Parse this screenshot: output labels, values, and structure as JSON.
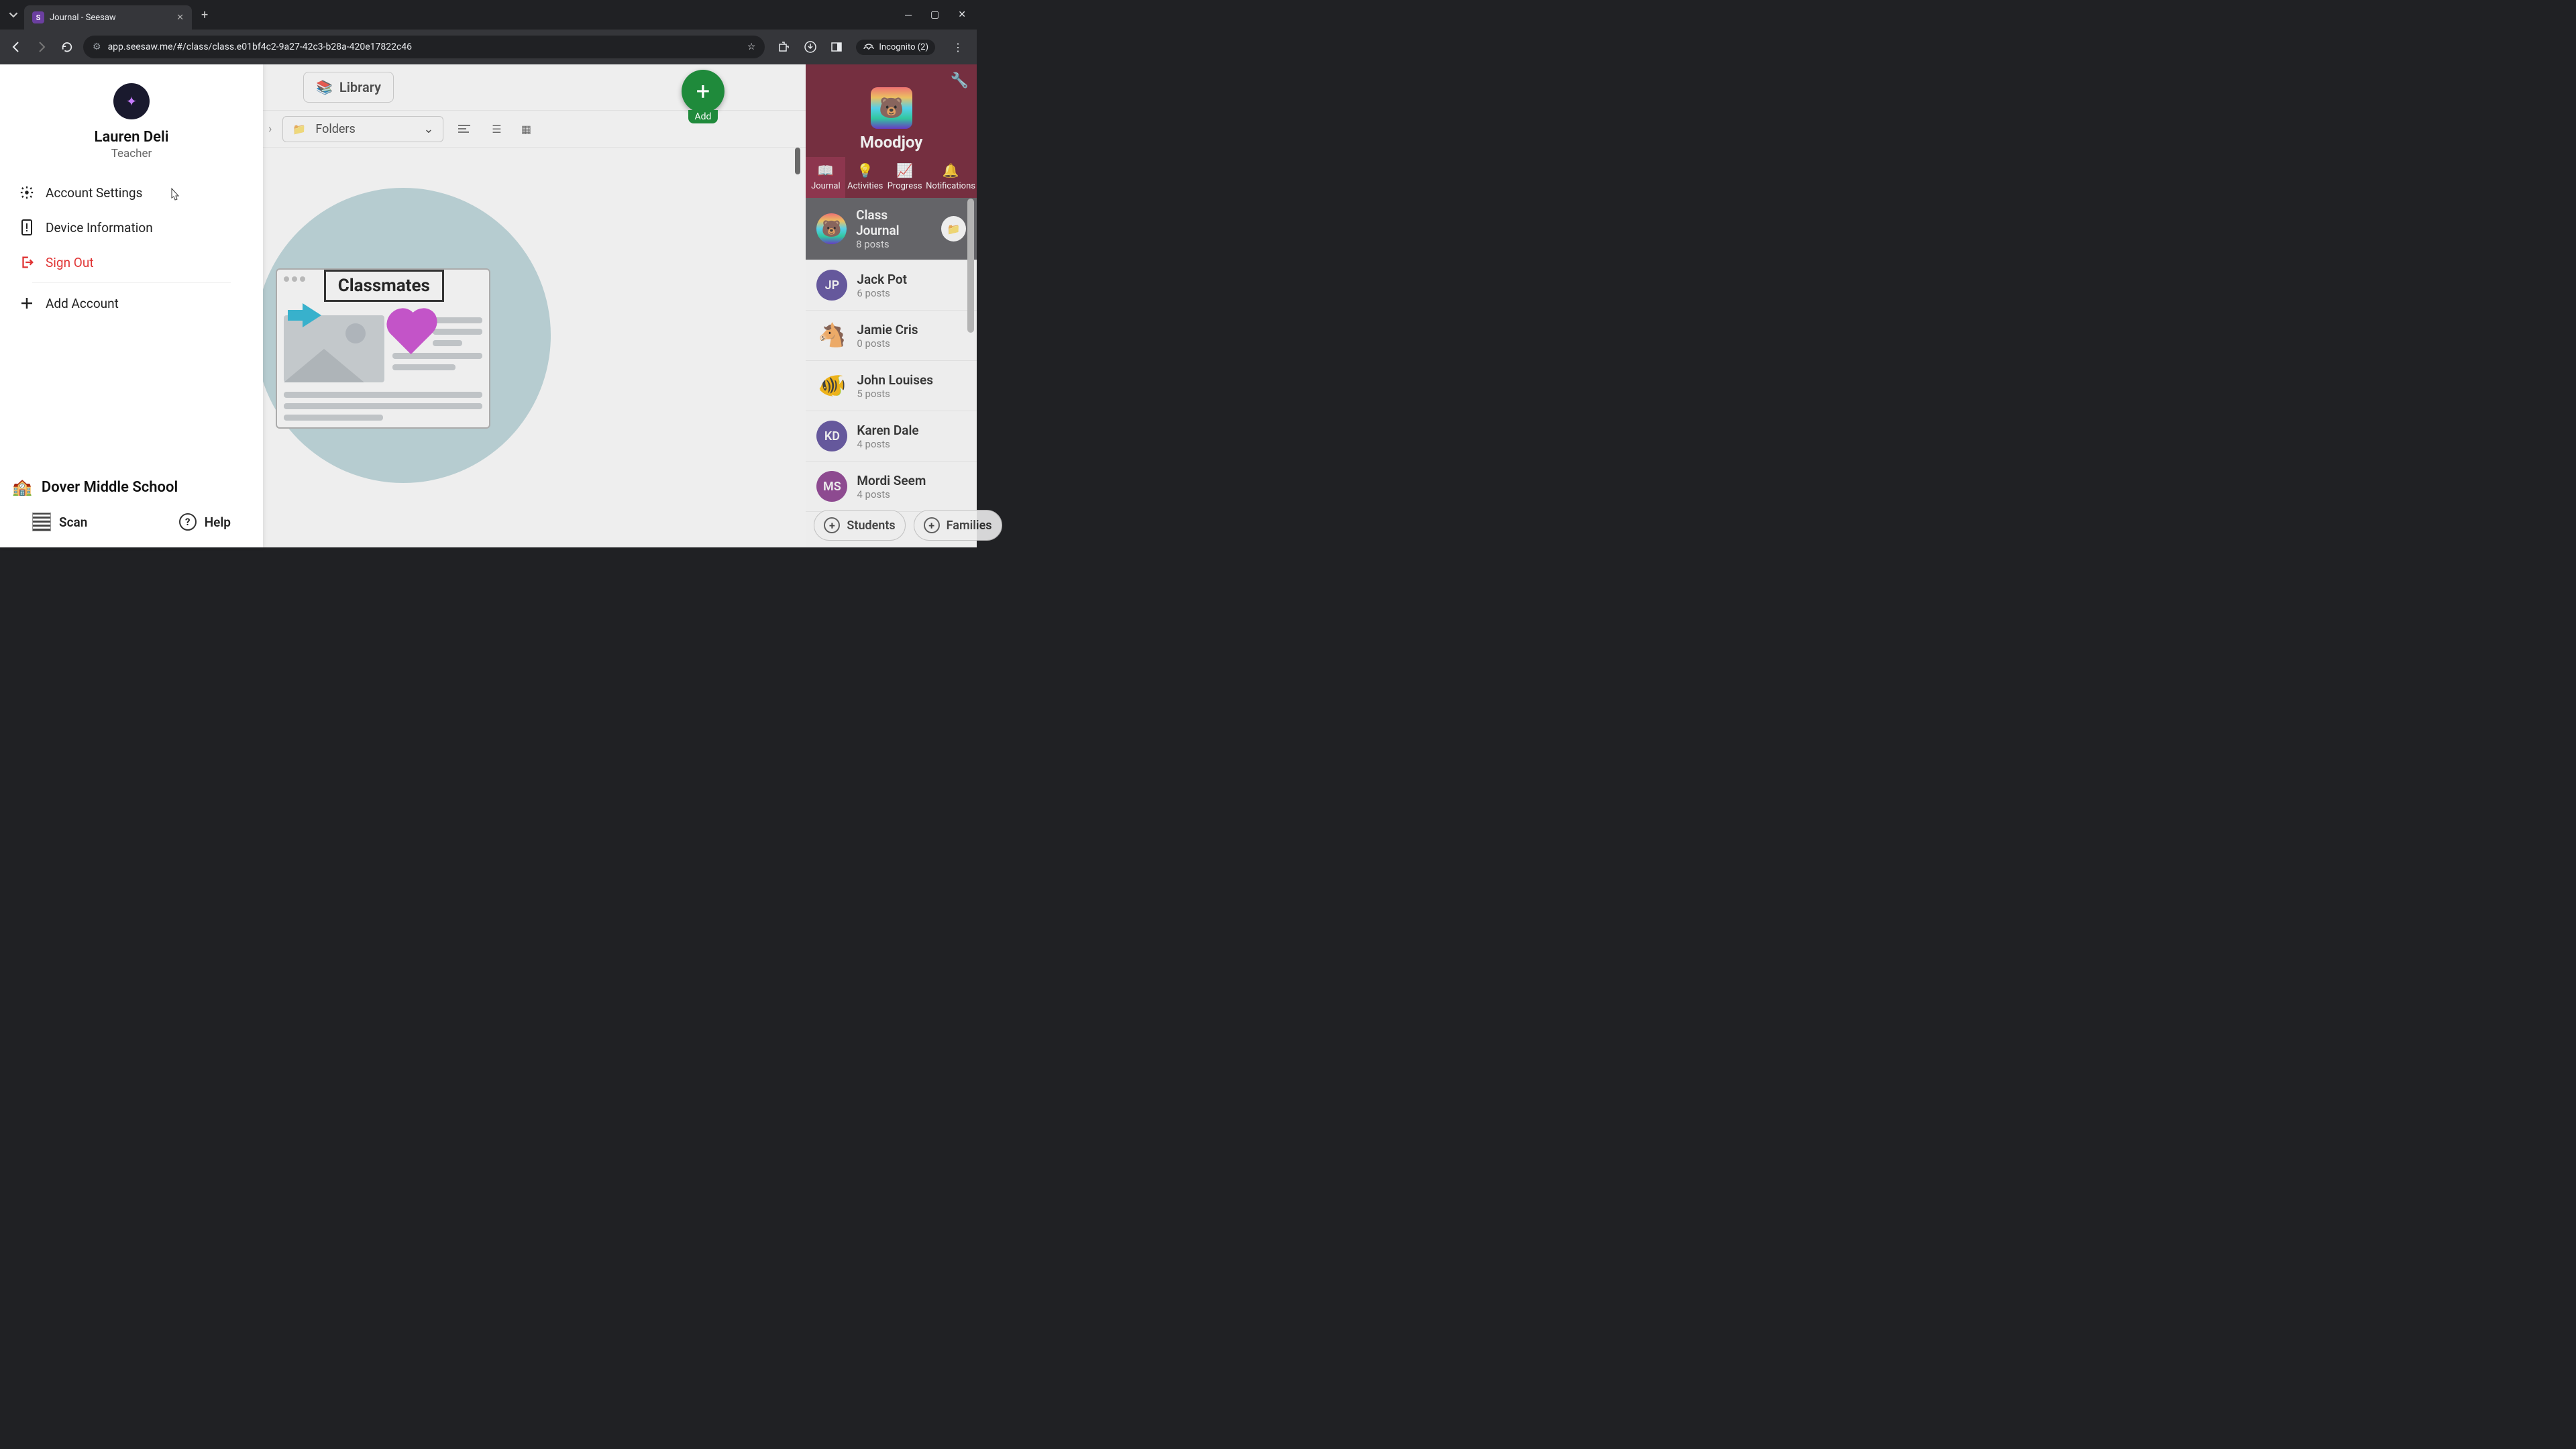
{
  "browser": {
    "tab_title": "Journal - Seesaw",
    "url": "app.seesaw.me/#/class/class.e01bf4c2-9a27-42c3-b28a-420e17822c46",
    "incognito_label": "Incognito (2)"
  },
  "account_panel": {
    "name": "Lauren Deli",
    "role": "Teacher",
    "menu": {
      "settings": "Account Settings",
      "device": "Device Information",
      "signout": "Sign Out",
      "add_account": "Add Account"
    },
    "school": "Dover Middle School",
    "scan": "Scan",
    "help": "Help"
  },
  "topnav": {
    "library": "Library",
    "folders": "Folders"
  },
  "illustration": {
    "title": "Classmates"
  },
  "add_button": "Add",
  "class_header": {
    "name": "Moodjoy"
  },
  "right_tabs": {
    "journal": "Journal",
    "activities": "Activities",
    "progress": "Progress",
    "notifications": "Notifications"
  },
  "journal_list": [
    {
      "name": "Class Journal",
      "sub": "8 posts",
      "avatar_type": "img",
      "avatar": "🐻",
      "selected": true,
      "has_folder": true
    },
    {
      "name": "Jack Pot",
      "sub": "6 posts",
      "avatar_type": "initials",
      "avatar": "JP",
      "bg": "#5b4b9e"
    },
    {
      "name": "Jamie Cris",
      "sub": "0 posts",
      "avatar_type": "emoji",
      "avatar": "🐴"
    },
    {
      "name": "John Louises",
      "sub": "5 posts",
      "avatar_type": "emoji",
      "avatar": "🐠"
    },
    {
      "name": "Karen Dale",
      "sub": "4 posts",
      "avatar_type": "initials",
      "avatar": "KD",
      "bg": "#5b4b9e"
    },
    {
      "name": "Mordi Seem",
      "sub": "4 posts",
      "avatar_type": "initials",
      "avatar": "MS",
      "bg": "#8c3b8f"
    }
  ],
  "right_footer": {
    "students": "Students",
    "families": "Families"
  }
}
